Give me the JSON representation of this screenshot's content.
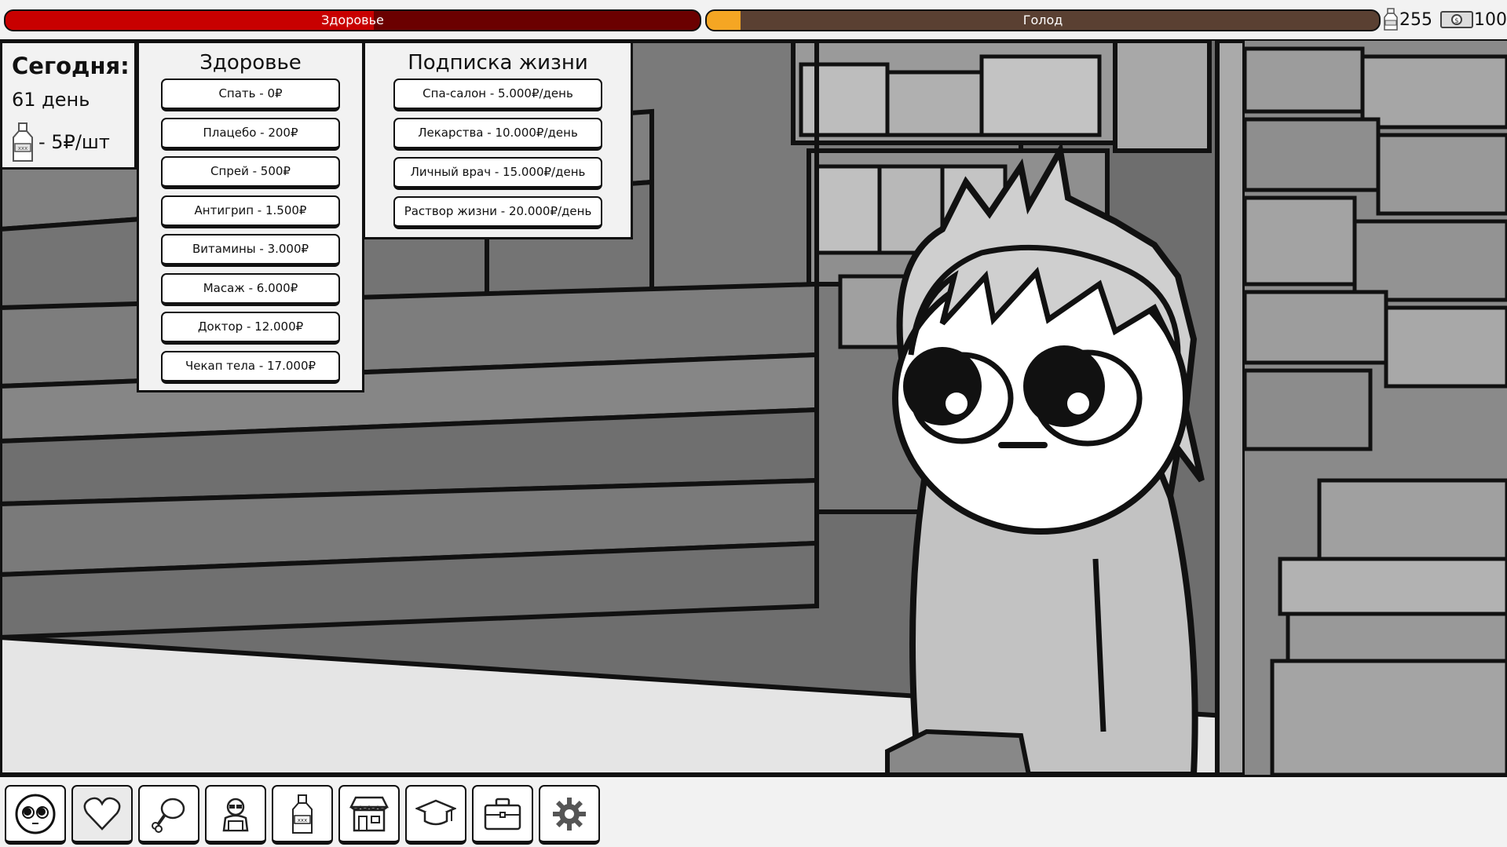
{
  "hud": {
    "health": {
      "label": "Здоровье",
      "fraction": 0.53
    },
    "hunger": {
      "label": "Голод",
      "fraction": 0.05
    },
    "bottles": "255",
    "money": "100"
  },
  "today": {
    "title": "Сегодня:",
    "day": "61 день",
    "bottle_price": "- 5₽/шт"
  },
  "health_menu": {
    "title": "Здоровье",
    "items": [
      "Спать - 0₽",
      "Плацебо - 200₽",
      "Спрей - 500₽",
      "Антигрип - 1.500₽",
      "Витамины - 3.000₽",
      "Масаж - 6.000₽",
      "Доктор - 12.000₽",
      "Чекап тела - 17.000₽"
    ]
  },
  "subscription_menu": {
    "title": "Подписка жизни",
    "items": [
      "Спа-салон - 5.000₽/день",
      "Лекарства - 10.000₽/день",
      "Личный врач - 15.000₽/день",
      "Раствор жизни - 20.000₽/день"
    ]
  },
  "toolbar": {
    "icons": [
      "character-face-icon",
      "heart-icon",
      "meat-icon",
      "hacker-icon",
      "bottle-icon",
      "shop-icon",
      "graduation-cap-icon",
      "briefcase-icon",
      "gear-icon"
    ],
    "active": "heart-icon"
  }
}
